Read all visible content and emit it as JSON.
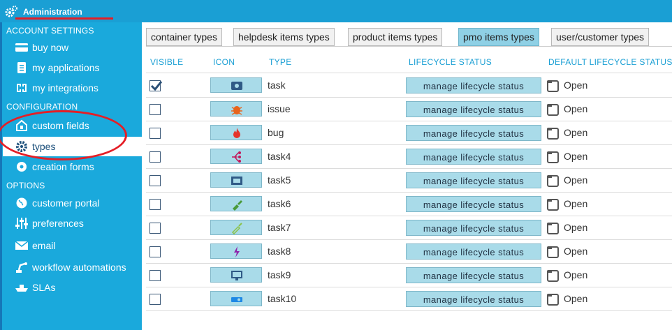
{
  "topbar": {
    "title": "Administration"
  },
  "sidebar": {
    "sections": {
      "account": "ACCOUNT SETTINGS",
      "configuration": "CONFIGURATION",
      "options": "OPTIONS"
    },
    "items": [
      {
        "label": "buy now",
        "icon": "credit-card-icon"
      },
      {
        "label": "my applications",
        "icon": "clipboard-icon"
      },
      {
        "label": "my integrations",
        "icon": "integrations-icon"
      },
      {
        "label": "custom fields",
        "icon": "custom-fields-icon"
      },
      {
        "label": "types",
        "icon": "gear-icon",
        "active": true
      },
      {
        "label": "creation forms",
        "icon": "badge-gear-icon"
      },
      {
        "label": "customer portal",
        "icon": "globe-icon"
      },
      {
        "label": "preferences",
        "icon": "sliders-icon"
      },
      {
        "label": "email",
        "icon": "envelope-icon"
      },
      {
        "label": "workflow automations",
        "icon": "robot-arm-icon"
      },
      {
        "label": "SLAs",
        "icon": "ship-icon"
      }
    ]
  },
  "tabs": [
    {
      "label": "container types"
    },
    {
      "label": "helpdesk items types"
    },
    {
      "label": "product items types"
    },
    {
      "label": "pmo items types",
      "active": true
    },
    {
      "label": "user/customer types"
    }
  ],
  "table": {
    "headers": {
      "visible": "VISIBLE",
      "icon": "ICON",
      "type": "TYPE",
      "lifecycle": "LIFECYCLE STATUS",
      "default_lifecycle": "DEFAULT LIFECYCLE STATUS"
    },
    "button_label": "manage lifecycle status",
    "rows": [
      {
        "type": "task",
        "visible": true,
        "icon": "task-icon",
        "default_status": "Open"
      },
      {
        "type": "issue",
        "visible": false,
        "icon": "bug-issue-icon",
        "default_status": "Open"
      },
      {
        "type": "bug",
        "visible": false,
        "icon": "flame-icon",
        "default_status": "Open"
      },
      {
        "type": "task4",
        "visible": false,
        "icon": "branch-icon",
        "default_status": "Open"
      },
      {
        "type": "task5",
        "visible": false,
        "icon": "ticket-icon",
        "default_status": "Open"
      },
      {
        "type": "task6",
        "visible": false,
        "icon": "brush-icon",
        "default_status": "Open"
      },
      {
        "type": "task7",
        "visible": false,
        "icon": "syringe-icon",
        "default_status": "Open"
      },
      {
        "type": "task8",
        "visible": false,
        "icon": "lightning-icon",
        "default_status": "Open"
      },
      {
        "type": "task9",
        "visible": false,
        "icon": "monitor-icon",
        "default_status": "Open"
      },
      {
        "type": "task10",
        "visible": false,
        "icon": "projector-icon",
        "default_status": "Open"
      }
    ]
  },
  "colors": {
    "accent": "#1a9fd4",
    "sidebar": "#1aa9dc",
    "highlight": "#e41e26",
    "button": "#a9dbe9"
  }
}
